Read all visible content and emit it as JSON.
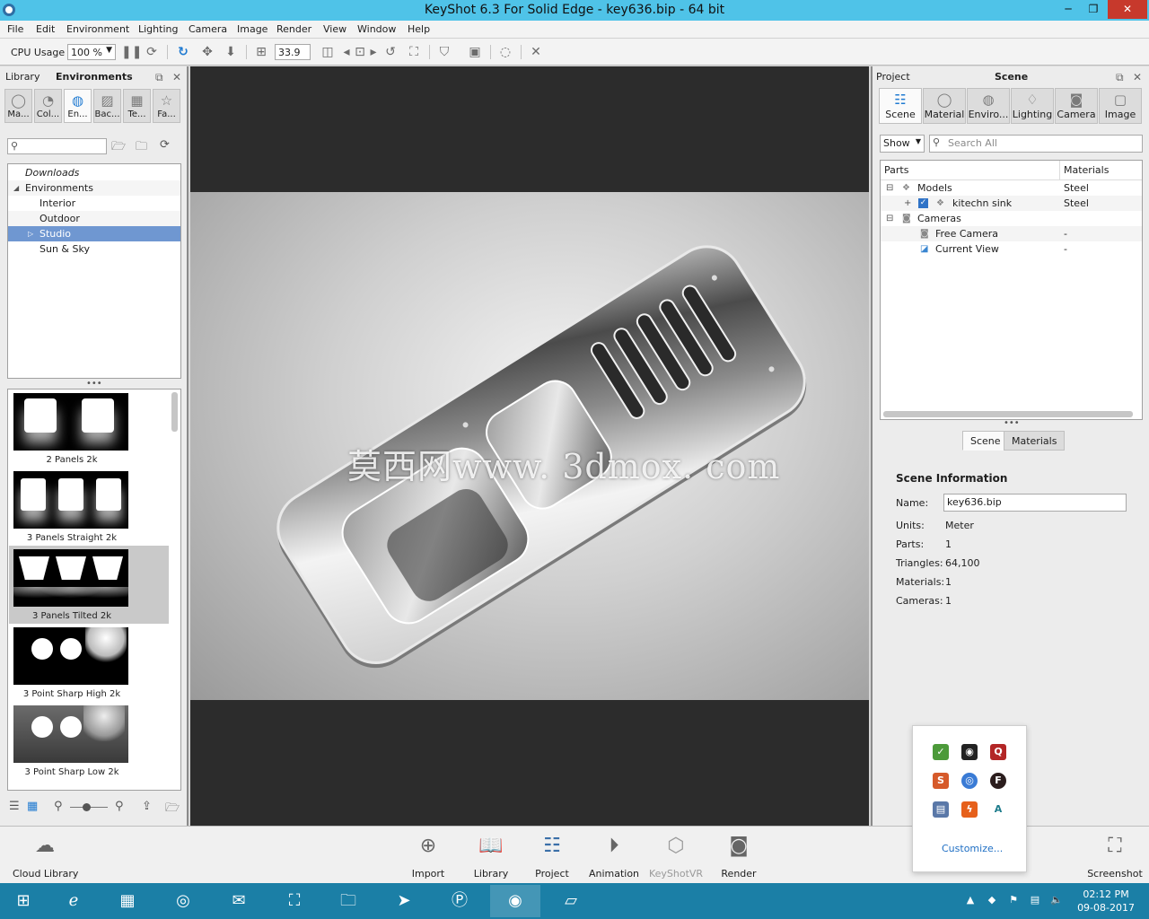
{
  "window": {
    "title": "KeyShot 6.3 For Solid Edge - key636.bip  - 64 bit",
    "min": "─",
    "max": "❐",
    "close": "✕"
  },
  "menu": [
    "File",
    "Edit",
    "Environment",
    "Lighting",
    "Camera",
    "Image",
    "Render",
    "View",
    "Window",
    "Help"
  ],
  "toolbar": {
    "cpu_label": "CPU Usage",
    "cpu_value": "100 %",
    "fov_value": "33.9"
  },
  "library_panel": {
    "title": "Library",
    "active_title": "Environments",
    "tabs": [
      {
        "label": "Ma...",
        "icon": "material-icon"
      },
      {
        "label": "Col...",
        "icon": "color-icon"
      },
      {
        "label": "En...",
        "icon": "environment-icon"
      },
      {
        "label": "Bac...",
        "icon": "backplate-icon"
      },
      {
        "label": "Te...",
        "icon": "texture-icon"
      },
      {
        "label": "Fa...",
        "icon": "favorites-icon"
      }
    ],
    "tree": {
      "downloads": "Downloads",
      "environments": "Environments",
      "interior": "Interior",
      "outdoor": "Outdoor",
      "studio": "Studio",
      "sun_sky": "Sun & Sky"
    },
    "thumbnails": [
      "2 Panels 2k",
      "3 Panels Straight 2k",
      "3 Panels Tilted 2k",
      "3 Point Sharp High 2k",
      "3 Point Sharp Low 2k"
    ],
    "selected_thumbnail": "3 Panels Tilted 2k"
  },
  "viewport": {
    "watermark": "莫西网www. 3dmox. com"
  },
  "project_panel": {
    "title": "Project",
    "active_title": "Scene",
    "tabs": [
      "Scene",
      "Material",
      "Enviro...",
      "Lighting",
      "Camera",
      "Image"
    ],
    "show_label": "Show",
    "search_placeholder": "Search All",
    "columns": {
      "parts": "Parts",
      "materials": "Materials"
    },
    "tree": {
      "models": "Models",
      "models_mat": "Steel",
      "sink": "kitechn sink",
      "sink_mat": "Steel",
      "cameras": "Cameras",
      "free_camera": "Free Camera",
      "free_camera_mat": "-",
      "current_view": "Current View",
      "current_view_mat": "-"
    },
    "subtabs": [
      "Scene",
      "Materials"
    ],
    "scene_info": {
      "title": "Scene Information",
      "name_label": "Name:",
      "name_value": "key636.bip",
      "units_label": "Units:",
      "units_value": "Meter",
      "parts_label": "Parts:",
      "parts_value": "1",
      "triangles_label": "Triangles:",
      "triangles_value": "64,100",
      "materials_label": "Materials:",
      "materials_value": "1",
      "cameras_label": "Cameras:",
      "cameras_value": "1"
    }
  },
  "tray_popup": {
    "customize": "Customize..."
  },
  "bottom_toolbar": {
    "cloud_library": "Cloud Library",
    "import": "Import",
    "library": "Library",
    "project": "Project",
    "animation": "Animation",
    "keyshotvr": "KeyShotVR",
    "render": "Render",
    "screenshot": "Screenshot"
  },
  "taskbar": {
    "time": "02:12 PM",
    "date": "09-08-2017"
  },
  "colors": {
    "title_bar": "#4fc3e8",
    "accent": "#1f7ad1",
    "selection": "#6f97d1",
    "taskbar": "#1b7fa6",
    "close": "#c7392c"
  }
}
